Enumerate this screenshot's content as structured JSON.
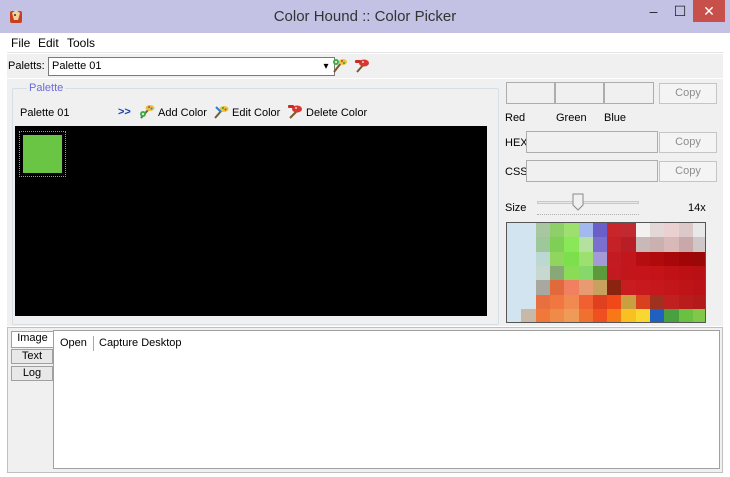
{
  "window": {
    "title": "Color Hound :: Color Picker",
    "controls": {
      "minimize": "–",
      "maximize": "☐",
      "close": "✕"
    },
    "icon": "app-icon"
  },
  "menu": [
    "File",
    "Edit",
    "Tools"
  ],
  "toolbar": {
    "palette_label": "Paletts:",
    "selected_palette": "Palette 01",
    "icons": [
      "add-palette-icon",
      "delete-palette-icon"
    ]
  },
  "palette": {
    "group_title": "Palette",
    "name": "Palette 01",
    "arrows": ">>",
    "actions": [
      {
        "label": "Add Color",
        "icon": "add-color-icon"
      },
      {
        "label": "Edit Color",
        "icon": "edit-color-icon"
      },
      {
        "label": "Delete Color",
        "icon": "delete-color-icon"
      }
    ],
    "swatches": [
      "#69c543"
    ]
  },
  "picker": {
    "rgb_labels": [
      "Red",
      "Green",
      "Blue"
    ],
    "hex_label": "HEX",
    "css_label": "CSS",
    "copy_label": "Copy",
    "size_label": "Size",
    "size_value": "14x",
    "slider_level": 0.4
  },
  "bottom": {
    "tabs": [
      "Image",
      "Text",
      "Log"
    ],
    "active_tab": "Image",
    "image_actions": [
      "Open",
      "Capture Desktop"
    ]
  },
  "colors": {
    "titlebar": "#c3c1e4",
    "close_button": "#c7504a",
    "group_title": "#6a6adf",
    "arrows": "#1a3fb0"
  }
}
